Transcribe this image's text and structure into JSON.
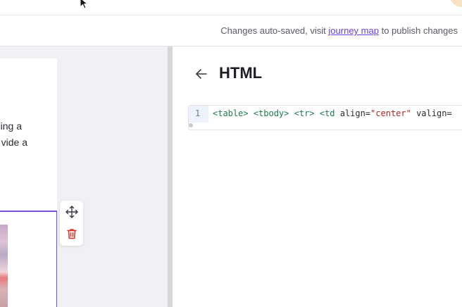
{
  "subbar": {
    "autosave_prefix": "Changes auto-saved, visit",
    "autosave_link": "journey map",
    "autosave_suffix": "to publish changes"
  },
  "email_card": {
    "text_line_1": "ing a",
    "text_line_2": "vide a"
  },
  "panel": {
    "title": "HTML",
    "code": {
      "line_number": "1",
      "tokens": {
        "t1": "<table>",
        "t2": "<tbody>",
        "t3": "<tr>",
        "t4": "<td",
        "a1": "align=",
        "s1": "\"center\"",
        "a2": "valign="
      }
    }
  },
  "colors": {
    "accent": "#7c4ddb",
    "link": "#6b3fd6",
    "delete": "#d93025"
  },
  "icons": {
    "move": "move-arrows-icon",
    "delete": "trash-icon",
    "back": "arrow-left-icon",
    "cursor": "mouse-cursor-icon"
  }
}
